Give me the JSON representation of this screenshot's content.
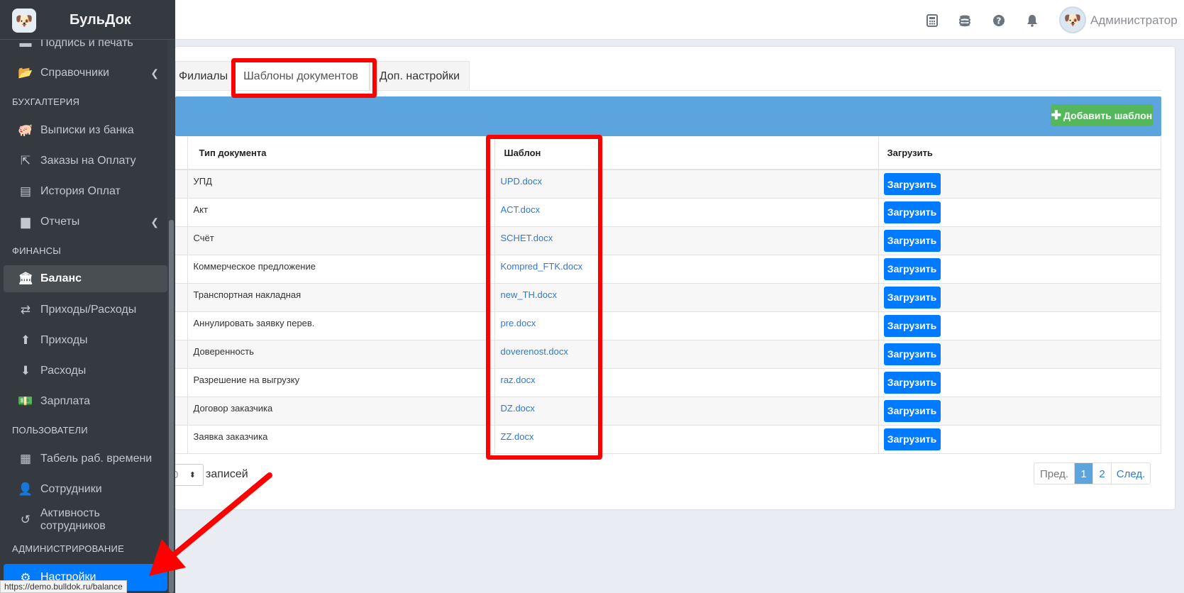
{
  "brand": {
    "name": "БульДок",
    "logo_icon": "bulldog-logo"
  },
  "topbar": {
    "icons": [
      "calculator-icon",
      "coins-icon",
      "question-circle-icon",
      "bell-icon"
    ],
    "user_name": "Администратор"
  },
  "sidebar": {
    "items": [
      {
        "label": "Подпись и печать",
        "icon": "stamp-icon"
      },
      {
        "label": "Справочники",
        "icon": "folder-open-icon",
        "has_arrow": true
      },
      {
        "label": "Выписки из банка",
        "icon": "piggy-bank-icon"
      },
      {
        "label": "Заказы на Оплату",
        "icon": "external-link-icon"
      },
      {
        "label": "История Оплат",
        "icon": "archive-icon"
      },
      {
        "label": "Отчеты",
        "icon": "book-icon",
        "has_arrow": true
      },
      {
        "label": "Баланс",
        "icon": "bank-icon",
        "active": true
      },
      {
        "label": "Приходы/Расходы",
        "icon": "retweet-icon"
      },
      {
        "label": "Приходы",
        "icon": "arrow-circle-up-icon"
      },
      {
        "label": "Расходы",
        "icon": "arrow-circle-down-icon"
      },
      {
        "label": "Зарплата",
        "icon": "money-bill-icon"
      },
      {
        "label": "Табель раб. времени",
        "icon": "table-icon"
      },
      {
        "label": "Сотрудники",
        "icon": "user-icon"
      },
      {
        "label": "Активность сотрудников",
        "icon": "history-icon"
      },
      {
        "label": "Настройки",
        "icon": "gear-icon",
        "selected": true
      }
    ],
    "headers": {
      "accounting": "БУХГАЛТЕРИЯ",
      "finance": "ФИНАНСЫ",
      "users": "ПОЛЬЗОВАТЕЛИ",
      "admin": "АДМИНИСТРИРОВАНИЕ"
    }
  },
  "tabs": {
    "branches": "Филиалы",
    "templates": "Шаблоны документов",
    "extra": "Доп. настройки"
  },
  "toolbar": {
    "add_template": "Добавить шаблон"
  },
  "table": {
    "headers": {
      "doc_type": "Тип документа",
      "template": "Шаблон",
      "upload": "Загрузить"
    },
    "upload_label": "Загрузить",
    "rows": [
      {
        "type": "УПД",
        "file": "UPD.docx"
      },
      {
        "type": "Акт",
        "file": "ACT.docx"
      },
      {
        "type": "Счёт",
        "file": "SCHET.docx"
      },
      {
        "type": "Коммерческое предложение",
        "file": "Kompred_FTK.docx"
      },
      {
        "type": "Транспортная накладная",
        "file": "new_TH.docx"
      },
      {
        "type": "Аннулировать заявку перев.",
        "file": "pre.docx"
      },
      {
        "type": "Доверенность",
        "file": "doverenost.docx"
      },
      {
        "type": "Разрешение на выгрузку",
        "file": "raz.docx"
      },
      {
        "type": "Договор заказчика",
        "file": "DZ.docx"
      },
      {
        "type": "Заявка заказчика",
        "file": "ZZ.docx"
      }
    ]
  },
  "footer": {
    "page_size_value": "0",
    "records_label": "записей",
    "pager": {
      "prev": "Пред.",
      "current": "1",
      "page2": "2",
      "next": "След."
    }
  },
  "status_url": "https://demo.bulldok.ru/balance",
  "colors": {
    "accent_blue": "#007bff",
    "band_blue": "#5ba4de",
    "annotation_red": "#ff0000",
    "add_green": "#55b75b"
  }
}
